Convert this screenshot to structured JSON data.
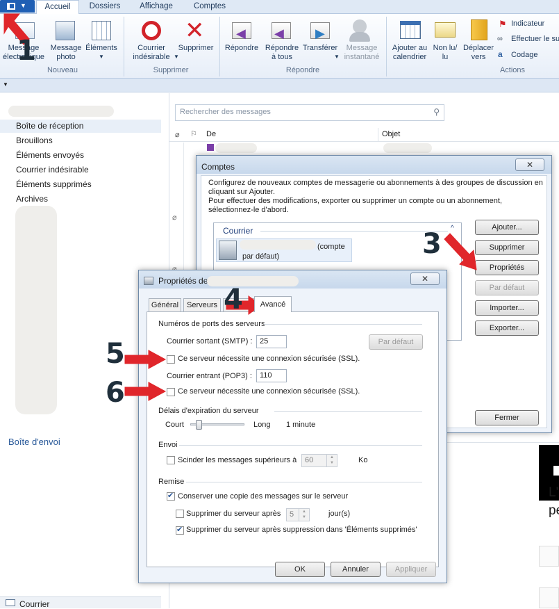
{
  "ribbon": {
    "tabs": [
      "Accueil",
      "Dossiers",
      "Affichage",
      "Comptes"
    ],
    "groups": {
      "nouveau": {
        "label": "Nouveau",
        "buttons": [
          "Message électronique",
          "Message photo",
          "Éléments"
        ]
      },
      "supprimer": {
        "label": "Supprimer",
        "buttons": [
          "Courrier indésirable",
          "Supprimer"
        ]
      },
      "repondre": {
        "label": "Répondre",
        "buttons": [
          "Répondre",
          "Répondre à tous",
          "Transférer",
          "Message instantané"
        ]
      },
      "actions": {
        "label": "Actions",
        "buttons": [
          "Ajouter au calendrier",
          "Non lu/ lu",
          "Déplacer vers"
        ],
        "small_buttons": [
          "Indicateur",
          "Effectuer le su",
          "Codage"
        ]
      }
    }
  },
  "sidebar": {
    "folders": [
      "Boîte de réception",
      "Brouillons",
      "Éléments envoyés",
      "Courrier indésirable",
      "Éléments supprimés",
      "Archives"
    ],
    "outbox": "Boîte d'envoi",
    "bottom_nav": "Courrier"
  },
  "message_list": {
    "search_placeholder": "Rechercher des messages",
    "columns": [
      "De",
      "Objet"
    ]
  },
  "accounts_dialog": {
    "title": "Comptes",
    "description_1": "Configurez de nouveaux comptes de messagerie ou abonnements à des groupes de discussion en cliquant sur Ajouter.",
    "description_2": "Pour effectuer des modifications, exporter ou supprimer un compte ou un abonnement, sélectionnez-le d'abord.",
    "section": "Courrier",
    "account_suffix": "(compte par défaut)",
    "buttons": [
      "Ajouter...",
      "Supprimer",
      "Propriétés",
      "Par défaut",
      "Importer...",
      "Exporter..."
    ],
    "close": "Fermer"
  },
  "properties_dialog": {
    "title": "Propriétés de",
    "tabs": [
      "Général",
      "Serveurs",
      "Avancé"
    ],
    "ports_section": "Numéros de ports des serveurs",
    "smtp_label": "Courrier sortant (SMTP) :",
    "smtp_value": "25",
    "default_button": "Par défaut",
    "ssl_label": "Ce serveur nécessite une connexion sécurisée (SSL).",
    "pop3_label": "Courrier entrant (POP3) :",
    "pop3_value": "110",
    "timeout_section": "Délais d'expiration du serveur",
    "timeout_short": "Court",
    "timeout_long": "Long",
    "timeout_value": "1 minute",
    "timeout_level": 0.1,
    "send_section": "Envoi",
    "split_label": "Scinder les messages supérieurs à",
    "split_value": "60",
    "split_unit": "Ko",
    "delivery_section": "Remise",
    "keep_copy_label": "Conserver une copie des messages sur le serveur",
    "delete_after_label": "Supprimer du serveur après",
    "delete_after_value": "5",
    "delete_after_unit": "jour(s)",
    "delete_on_remove_label": "Supprimer du serveur après suppression dans 'Éléments supprimés'",
    "ok": "OK",
    "cancel": "Annuler",
    "apply": "Appliquer"
  },
  "annotations": [
    "1",
    "3",
    "4",
    "5",
    "6"
  ],
  "colors": {
    "arrow": "#e0262b",
    "file_button": "#1f5fb4",
    "ribbon_text": "#1e395b"
  },
  "right_edge": {
    "line1": "L'",
    "line2": "pe"
  }
}
